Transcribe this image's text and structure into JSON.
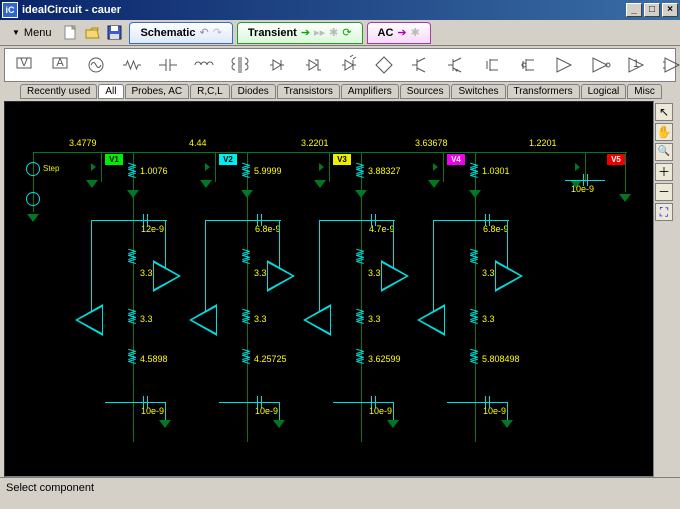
{
  "window": {
    "icon_text": "iC",
    "title": "idealCircuit - cauer"
  },
  "menu": {
    "label": "Menu"
  },
  "tabs": {
    "schematic": "Schematic",
    "transient": "Transient",
    "ac": "AC"
  },
  "categories": [
    "Recently used",
    "All",
    "Probes, AC",
    "R,C,L",
    "Diodes",
    "Transistors",
    "Amplifiers",
    "Sources",
    "Switches",
    "Transformers",
    "Logical",
    "Misc"
  ],
  "status": "Select component",
  "schematic": {
    "step_label": "Step",
    "probes": {
      "v1": "V1",
      "v2": "V2",
      "v3": "V3",
      "v4": "V4",
      "v5": "V5"
    },
    "top_inductors": [
      "3.4779",
      "4.44",
      "3.2201",
      "3.63678",
      "1.2201"
    ],
    "r_top": [
      "1.0076",
      "5.9999",
      "3.88327",
      "1.0301"
    ],
    "c_upper": [
      "12e-9",
      "6.8e-9",
      "4.7e-9",
      "6.8e-9"
    ],
    "c_right": "10e-9",
    "r_mid": [
      "3.3",
      "3.3",
      "3.3",
      "3.3"
    ],
    "r_mid2": [
      "3.3",
      "3.3",
      "3.3",
      "3.3"
    ],
    "r_bottom": [
      "4.5898",
      "4.25725",
      "3.62599",
      "5.808498"
    ],
    "c_bottom": [
      "10e-9",
      "10e-9",
      "10e-9",
      "10e-9"
    ]
  }
}
